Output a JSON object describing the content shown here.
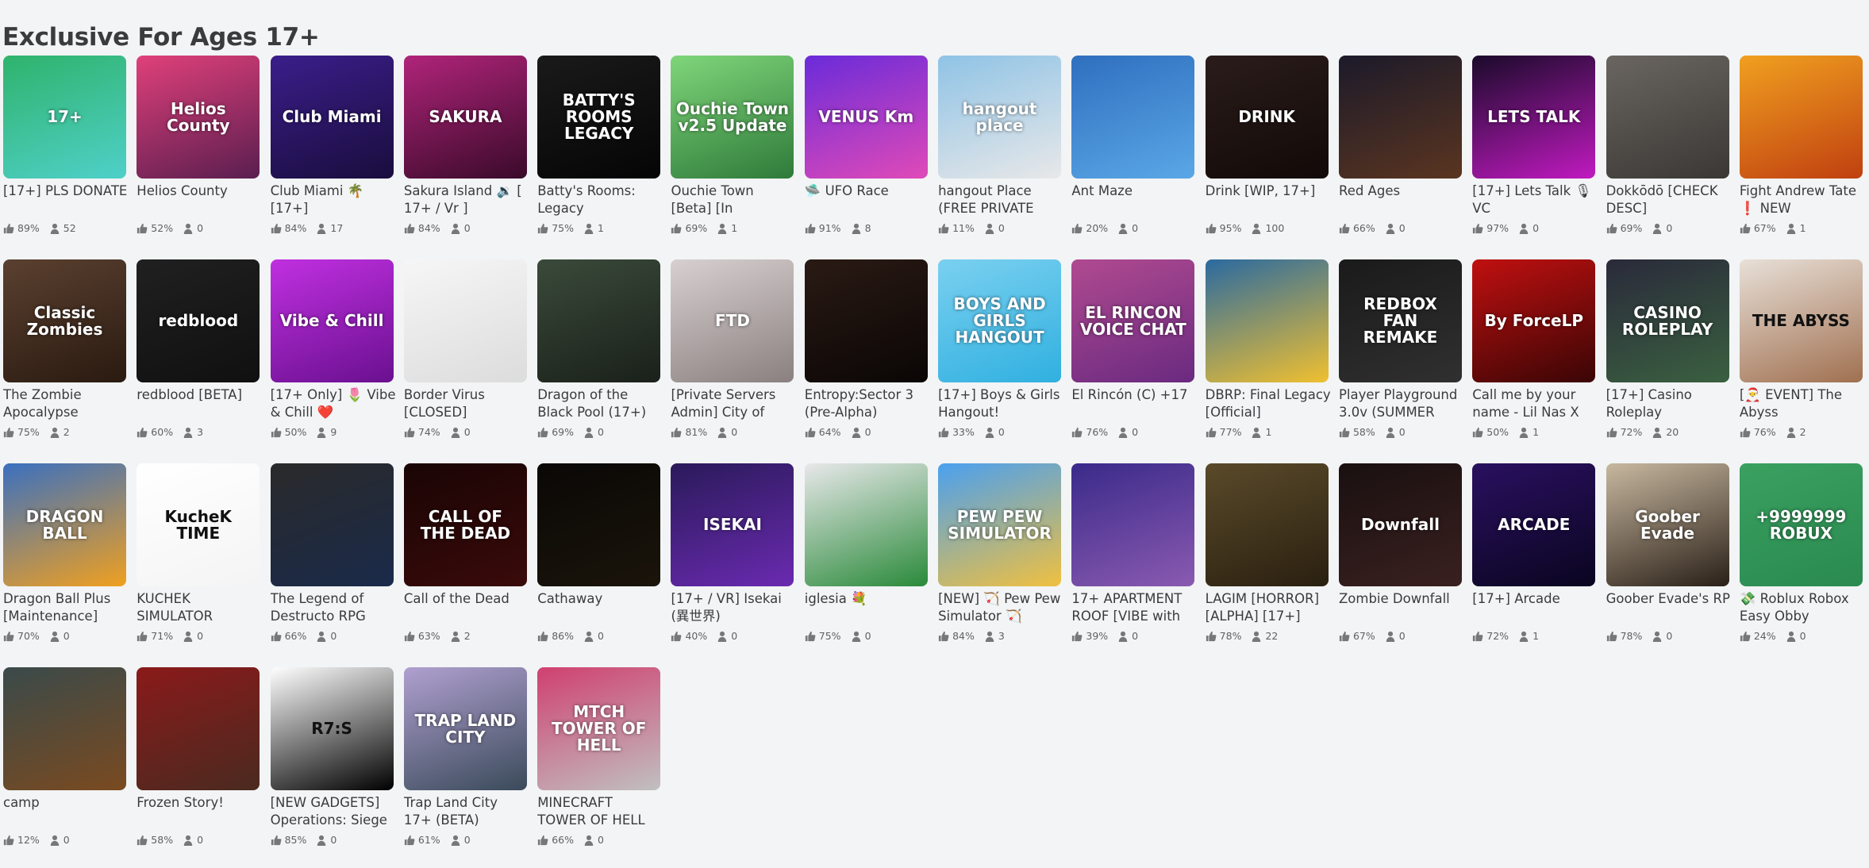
{
  "section": {
    "title": "Exclusive For Ages 17+"
  },
  "games": [
    {
      "name": "[17+] PLS DONATE",
      "rating": "89%",
      "players": "52",
      "thumb_caption": "17+",
      "thumb_bg": [
        "#2fb36c",
        "#4fd0c9"
      ]
    },
    {
      "name": "Helios County",
      "rating": "52%",
      "players": "0",
      "thumb_caption": "Helios County",
      "thumb_bg": [
        "#e0407a",
        "#5a1e4f"
      ]
    },
    {
      "name": "Club Miami 🌴 [17+]",
      "rating": "84%",
      "players": "17",
      "thumb_caption": "Club Miami",
      "thumb_bg": [
        "#3a1e8a",
        "#1a0d3d"
      ]
    },
    {
      "name": "Sakura Island 🔉 [ 17+ / Vr ]",
      "rating": "84%",
      "players": "0",
      "thumb_caption": "SAKURA",
      "thumb_bg": [
        "#b0247a",
        "#3a0a2a"
      ]
    },
    {
      "name": "Batty's Rooms: Legacy",
      "rating": "75%",
      "players": "1",
      "thumb_caption": "BATTY'S ROOMS LEGACY",
      "thumb_bg": [
        "#1a1a1a",
        "#050505"
      ]
    },
    {
      "name": "Ouchie Town [Beta] [In",
      "rating": "69%",
      "players": "1",
      "thumb_caption": "Ouchie Town v2.5 Update",
      "thumb_bg": [
        "#7fd67a",
        "#2f7a3a"
      ]
    },
    {
      "name": "🛸 UFO Race",
      "rating": "91%",
      "players": "8",
      "thumb_caption": "VENUS Km",
      "thumb_bg": [
        "#6a2bd9",
        "#e04ab8"
      ]
    },
    {
      "name": "hangout Place (FREE PRIVATE",
      "rating": "11%",
      "players": "0",
      "thumb_caption": "hangout place",
      "thumb_bg": [
        "#8fc3e6",
        "#e8e8e8"
      ]
    },
    {
      "name": "Ant Maze",
      "rating": "20%",
      "players": "0",
      "thumb_caption": "",
      "thumb_bg": [
        "#2f6fbf",
        "#5aa7e6"
      ]
    },
    {
      "name": "Drink [WIP, 17+]",
      "rating": "95%",
      "players": "100",
      "thumb_caption": "DRINK",
      "thumb_bg": [
        "#2a1c1a",
        "#120a08"
      ]
    },
    {
      "name": "Red Ages",
      "rating": "66%",
      "players": "0",
      "thumb_caption": "",
      "thumb_bg": [
        "#1c1a2a",
        "#5a3520"
      ]
    },
    {
      "name": "[17+] Lets Talk 🎙 VC",
      "rating": "97%",
      "players": "0",
      "thumb_caption": "LETS TALK",
      "thumb_bg": [
        "#1a0a2a",
        "#c01ac0"
      ]
    },
    {
      "name": "Dokkōdō [CHECK DESC]",
      "rating": "69%",
      "players": "0",
      "thumb_caption": "",
      "thumb_bg": [
        "#6a6560",
        "#3a3835"
      ]
    },
    {
      "name": "Fight Andrew Tate ❗ NEW",
      "rating": "67%",
      "players": "1",
      "thumb_caption": "",
      "thumb_bg": [
        "#f0a020",
        "#c04010"
      ]
    },
    {
      "name": "The Zombie Apocalypse",
      "rating": "75%",
      "players": "2",
      "thumb_caption": "Classic Zombies",
      "thumb_bg": [
        "#5a4030",
        "#2a1a10"
      ]
    },
    {
      "name": "redblood [BETA]",
      "rating": "60%",
      "players": "3",
      "thumb_caption": "redblood",
      "thumb_bg": [
        "#202020",
        "#101010"
      ]
    },
    {
      "name": "[17+ Only] 🌷 Vibe & Chill ❤️",
      "rating": "50%",
      "players": "9",
      "thumb_caption": "Vibe & Chill",
      "thumb_bg": [
        "#c030e0",
        "#6a1090"
      ]
    },
    {
      "name": "Border Virus [CLOSED]",
      "rating": "74%",
      "players": "0",
      "thumb_caption": "",
      "thumb_bg": [
        "#f6f6f6",
        "#dcdcdc"
      ]
    },
    {
      "name": "Dragon of the Black Pool (17+)",
      "rating": "69%",
      "players": "0",
      "thumb_caption": "",
      "thumb_bg": [
        "#3a4a3a",
        "#1a201a"
      ]
    },
    {
      "name": "[Private Servers Admin] City of",
      "rating": "81%",
      "players": "0",
      "thumb_caption": "FTD",
      "thumb_bg": [
        "#d8d0d0",
        "#8a8080"
      ]
    },
    {
      "name": "Entropy:Sector 3 (Pre-Alpha)",
      "rating": "64%",
      "players": "0",
      "thumb_caption": "",
      "thumb_bg": [
        "#2a1a14",
        "#0a0605"
      ]
    },
    {
      "name": "[17+] Boys & Girls Hangout!",
      "rating": "33%",
      "players": "0",
      "thumb_caption": "BOYS AND GIRLS HANGOUT",
      "thumb_bg": [
        "#7ad0f0",
        "#30b0e0"
      ]
    },
    {
      "name": "El Rincón (C) +17",
      "rating": "76%",
      "players": "0",
      "thumb_caption": "EL RINCON VOICE CHAT",
      "thumb_bg": [
        "#b04a90",
        "#6a2a80"
      ]
    },
    {
      "name": "DBRP: Final Legacy [Official]",
      "rating": "77%",
      "players": "1",
      "thumb_caption": "",
      "thumb_bg": [
        "#2a6aa0",
        "#f0c030"
      ]
    },
    {
      "name": "Player Playground 3.0v (SUMMER",
      "rating": "58%",
      "players": "0",
      "thumb_caption": "REDBOX FAN REMAKE",
      "thumb_bg": [
        "#1a1a1a",
        "#303030"
      ]
    },
    {
      "name": "Call me by your name - Lil Nas X",
      "rating": "50%",
      "players": "1",
      "thumb_caption": "By ForceLP",
      "thumb_bg": [
        "#c01010",
        "#3a0505"
      ]
    },
    {
      "name": "[17+] Casino Roleplay",
      "rating": "72%",
      "players": "20",
      "thumb_caption": "CASINO ROLEPLAY",
      "thumb_bg": [
        "#2a2a3a",
        "#3a6040"
      ]
    },
    {
      "name": "[🎅 EVENT] The Abyss",
      "rating": "76%",
      "players": "2",
      "thumb_caption": "THE ABYSS",
      "thumb_bg": [
        "#e8e0d8",
        "#a07050"
      ]
    },
    {
      "name": "Dragon Ball Plus [Maintenance]",
      "rating": "70%",
      "players": "0",
      "thumb_caption": "DRAGON BALL",
      "thumb_bg": [
        "#3a70c0",
        "#f0a020"
      ]
    },
    {
      "name": "KUCHEK SIMULATOR",
      "rating": "71%",
      "players": "0",
      "thumb_caption": "KucheK TIME",
      "thumb_bg": [
        "#ffffff",
        "#f4f4f4"
      ]
    },
    {
      "name": "The Legend of Destructo RPG",
      "rating": "66%",
      "players": "0",
      "thumb_caption": "",
      "thumb_bg": [
        "#2a2a2a",
        "#1a2a4a"
      ]
    },
    {
      "name": "Call of the Dead",
      "rating": "63%",
      "players": "2",
      "thumb_caption": "CALL OF THE DEAD",
      "thumb_bg": [
        "#1a0505",
        "#3a0a0a"
      ]
    },
    {
      "name": "Cathaway",
      "rating": "86%",
      "players": "0",
      "thumb_caption": "",
      "thumb_bg": [
        "#0a0806",
        "#1a140a"
      ]
    },
    {
      "name": "[17+ / VR] Isekai (異世界)",
      "rating": "40%",
      "players": "0",
      "thumb_caption": "ISEKAI",
      "thumb_bg": [
        "#2a1a5a",
        "#6a2ab0"
      ]
    },
    {
      "name": "iglesia 💐",
      "rating": "75%",
      "players": "0",
      "thumb_caption": "",
      "thumb_bg": [
        "#e8e8ea",
        "#2a8a3a"
      ]
    },
    {
      "name": "[NEW] 🏹 Pew Pew Simulator 🏹",
      "rating": "84%",
      "players": "3",
      "thumb_caption": "PEW PEW SIMULATOR",
      "thumb_bg": [
        "#4aa0f0",
        "#f0c040"
      ]
    },
    {
      "name": "17+ APARTMENT ROOF [VIBE with",
      "rating": "39%",
      "players": "0",
      "thumb_caption": "",
      "thumb_bg": [
        "#3a2a8a",
        "#8a5ab0"
      ]
    },
    {
      "name": "LAGIM [HORROR] [ALPHA] [17+]",
      "rating": "78%",
      "players": "22",
      "thumb_caption": "",
      "thumb_bg": [
        "#5a4a2a",
        "#2a2010"
      ]
    },
    {
      "name": "Zombie Downfall",
      "rating": "67%",
      "players": "0",
      "thumb_caption": "Downfall",
      "thumb_bg": [
        "#1a1010",
        "#3a2020"
      ]
    },
    {
      "name": "[17+] Arcade",
      "rating": "72%",
      "players": "1",
      "thumb_caption": "ARCADE",
      "thumb_bg": [
        "#2a1060",
        "#0a0520"
      ]
    },
    {
      "name": "Goober Evade's RP",
      "rating": "78%",
      "players": "0",
      "thumb_caption": "Goober Evade",
      "thumb_bg": [
        "#c8b8a0",
        "#2a2018"
      ]
    },
    {
      "name": "💸 Roblux Robox Easy Obby",
      "rating": "24%",
      "players": "0",
      "thumb_caption": "+9999999 ROBUX",
      "thumb_bg": [
        "#3aa060",
        "#2a8a50"
      ]
    },
    {
      "name": "camp",
      "rating": "12%",
      "players": "0",
      "thumb_caption": "",
      "thumb_bg": [
        "#3a4a4a",
        "#7a4a20"
      ]
    },
    {
      "name": "Frozen Story!",
      "rating": "58%",
      "players": "0",
      "thumb_caption": "",
      "thumb_bg": [
        "#8a1a1a",
        "#4a2a20"
      ]
    },
    {
      "name": "[NEW GADGETS] Operations: Siege",
      "rating": "85%",
      "players": "0",
      "thumb_caption": "R7:S",
      "thumb_bg": [
        "#ffffff",
        "#000000"
      ]
    },
    {
      "name": "Trap Land City 17+ (BETA)",
      "rating": "61%",
      "players": "0",
      "thumb_caption": "TRAP LAND CITY",
      "thumb_bg": [
        "#b0a0d0",
        "#3a4a5a"
      ]
    },
    {
      "name": "MINECRAFT TOWER OF HELL",
      "rating": "66%",
      "players": "0",
      "thumb_caption": "MTCH TOWER OF HELL",
      "thumb_bg": [
        "#d04070",
        "#c0c0c0"
      ]
    }
  ],
  "icons": {
    "rating": "thumbs-up-icon",
    "players": "player-count-icon"
  }
}
